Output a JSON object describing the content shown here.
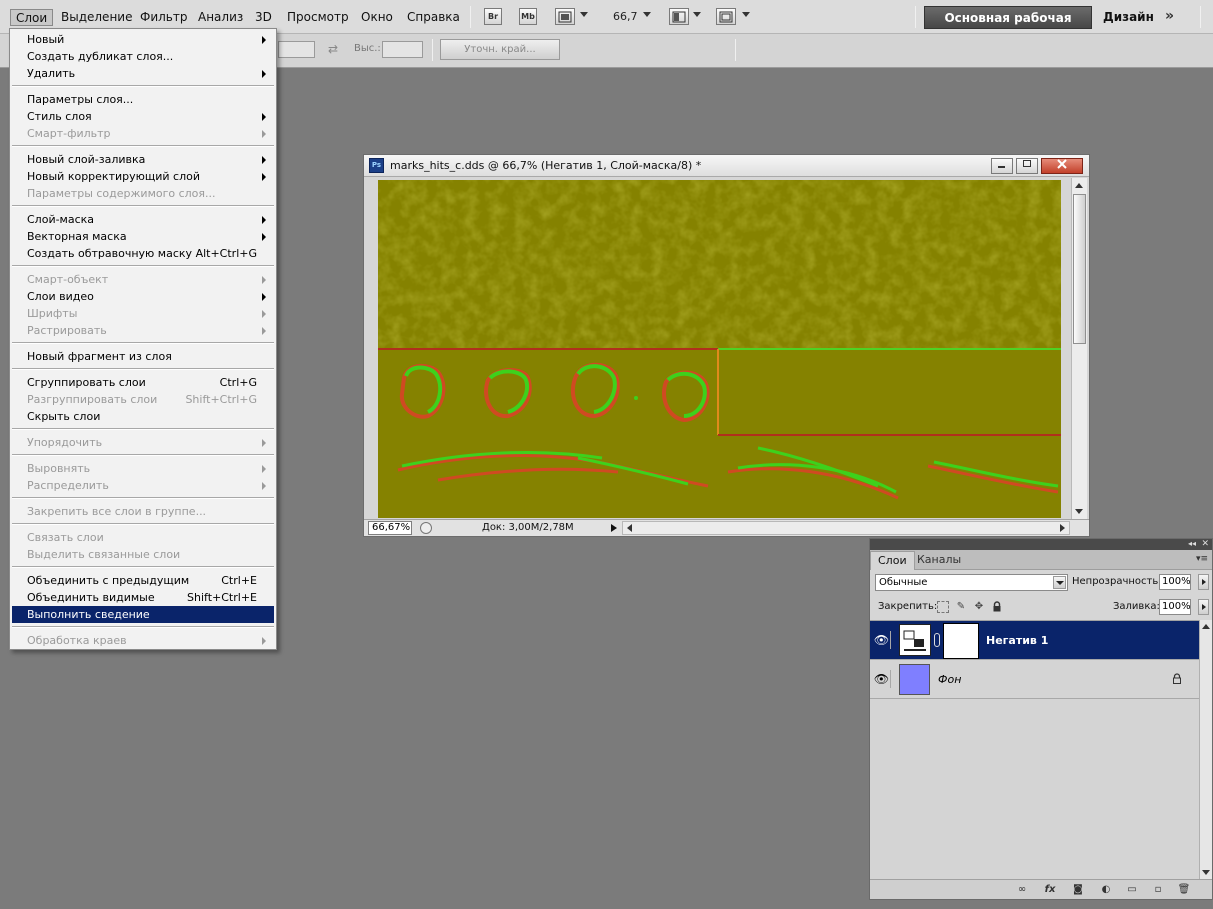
{
  "menubar": {
    "items": [
      "Слои",
      "Выделение",
      "Фильтр",
      "Анализ",
      "3D",
      "Просмотр",
      "Окно",
      "Справка"
    ],
    "br_label": "Br",
    "mb_label": "Mb",
    "zoom_value": "66,7",
    "workspace_button": "Основная рабочая среда",
    "design_button": "Дизайн",
    "more_button": "»"
  },
  "options_bar": {
    "height_label": "Выс.:",
    "refine_edge_button": "Уточн. край..."
  },
  "layer_menu": {
    "groups": [
      [
        {
          "label": "Новый",
          "shortcut": "",
          "submenu": true,
          "disabled": false
        },
        {
          "label": "Создать дубликат слоя...",
          "shortcut": "",
          "submenu": false,
          "disabled": false
        },
        {
          "label": "Удалить",
          "shortcut": "",
          "submenu": true,
          "disabled": false
        }
      ],
      [
        {
          "label": "Параметры слоя...",
          "shortcut": "",
          "submenu": false,
          "disabled": false
        },
        {
          "label": "Стиль слоя",
          "shortcut": "",
          "submenu": true,
          "disabled": false
        },
        {
          "label": "Смарт-фильтр",
          "shortcut": "",
          "submenu": true,
          "disabled": true
        }
      ],
      [
        {
          "label": "Новый слой-заливка",
          "shortcut": "",
          "submenu": true,
          "disabled": false
        },
        {
          "label": "Новый корректирующий слой",
          "shortcut": "",
          "submenu": true,
          "disabled": false
        },
        {
          "label": "Параметры содержимого слоя...",
          "shortcut": "",
          "submenu": false,
          "disabled": true
        }
      ],
      [
        {
          "label": "Слой-маска",
          "shortcut": "",
          "submenu": true,
          "disabled": false
        },
        {
          "label": "Векторная маска",
          "shortcut": "",
          "submenu": true,
          "disabled": false
        },
        {
          "label": "Создать обтравочную маску",
          "shortcut": "Alt+Ctrl+G",
          "submenu": false,
          "disabled": false
        }
      ],
      [
        {
          "label": "Смарт-объект",
          "shortcut": "",
          "submenu": true,
          "disabled": true
        },
        {
          "label": "Слои видео",
          "shortcut": "",
          "submenu": true,
          "disabled": false
        },
        {
          "label": "Шрифты",
          "shortcut": "",
          "submenu": true,
          "disabled": true
        },
        {
          "label": "Растрировать",
          "shortcut": "",
          "submenu": true,
          "disabled": true
        }
      ],
      [
        {
          "label": "Новый фрагмент из слоя",
          "shortcut": "",
          "submenu": false,
          "disabled": false
        }
      ],
      [
        {
          "label": "Сгруппировать слои",
          "shortcut": "Ctrl+G",
          "submenu": false,
          "disabled": false
        },
        {
          "label": "Разгруппировать слои",
          "shortcut": "Shift+Ctrl+G",
          "submenu": false,
          "disabled": true
        },
        {
          "label": "Скрыть слои",
          "shortcut": "",
          "submenu": false,
          "disabled": false
        }
      ],
      [
        {
          "label": "Упорядочить",
          "shortcut": "",
          "submenu": true,
          "disabled": true
        }
      ],
      [
        {
          "label": "Выровнять",
          "shortcut": "",
          "submenu": true,
          "disabled": true
        },
        {
          "label": "Распределить",
          "shortcut": "",
          "submenu": true,
          "disabled": true
        }
      ],
      [
        {
          "label": "Закрепить все слои в группе...",
          "shortcut": "",
          "submenu": false,
          "disabled": true
        }
      ],
      [
        {
          "label": "Связать слои",
          "shortcut": "",
          "submenu": false,
          "disabled": true
        },
        {
          "label": "Выделить связанные слои",
          "shortcut": "",
          "submenu": false,
          "disabled": true
        }
      ],
      [
        {
          "label": "Объединить с предыдущим",
          "shortcut": "Ctrl+E",
          "submenu": false,
          "disabled": false
        },
        {
          "label": "Объединить видимые",
          "shortcut": "Shift+Ctrl+E",
          "submenu": false,
          "disabled": false
        },
        {
          "label": "Выполнить сведение",
          "shortcut": "",
          "submenu": false,
          "disabled": false,
          "highlighted": true
        }
      ],
      [
        {
          "label": "Обработка краев",
          "shortcut": "",
          "submenu": true,
          "disabled": true
        }
      ]
    ]
  },
  "document": {
    "app_icon": "Ps",
    "title": "marks_hits_c.dds @ 66,7% (Негатив 1, Слой-маска/8) *",
    "zoom": "66,67%",
    "status": "Док: 3,00M/2,78M",
    "canvas_color": "#858200"
  },
  "layers_panel": {
    "tabs": [
      "Слои",
      "Каналы"
    ],
    "blend_mode": "Обычные",
    "opacity_label": "Непрозрачность:",
    "opacity_value": "100%",
    "lock_label": "Закрепить:",
    "fill_label": "Заливка:",
    "fill_value": "100%",
    "layers": [
      {
        "name": "Негатив 1",
        "selected": true
      },
      {
        "name": "Фон",
        "selected": false,
        "locked": true,
        "thumb_color": "#7f7fff"
      }
    ]
  }
}
